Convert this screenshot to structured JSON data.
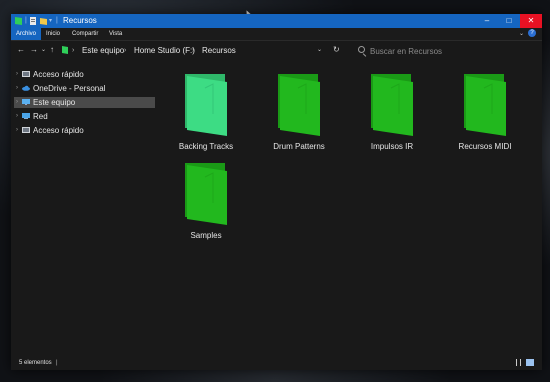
{
  "window": {
    "title": "Recursos",
    "min": "–",
    "max": "□",
    "close": "✕"
  },
  "ribbon": {
    "tabs": [
      "Archivo",
      "Inicio",
      "Compartir",
      "Vista"
    ],
    "help": "?",
    "expand": "⌄"
  },
  "nav": {
    "back": "←",
    "forward": "→",
    "recent": "⌄",
    "up": "↑",
    "breadcrumbs": [
      "Este equipo",
      "Home Studio (F:)",
      "Recursos"
    ],
    "dropdown": "⌄",
    "refresh": "↻",
    "search_placeholder": "Buscar en Recursos"
  },
  "sidebar": {
    "items": [
      {
        "label": "Acceso rápido",
        "icon": "quick-access-icon"
      },
      {
        "label": "OneDrive - Personal",
        "icon": "onedrive-cloud-icon"
      },
      {
        "label": "Este equipo",
        "icon": "this-pc-icon",
        "selected": true
      },
      {
        "label": "Red",
        "icon": "network-icon"
      },
      {
        "label": "Acceso rápido",
        "icon": "quick-access-icon"
      }
    ]
  },
  "folders": [
    {
      "name": "Backing Tracks",
      "color": "#3ddc84"
    },
    {
      "name": "Drum Patterns",
      "color": "#22b81e"
    },
    {
      "name": "Impulsos IR",
      "color": "#22b81e"
    },
    {
      "name": "Recursos MIDI",
      "color": "#22b81e"
    },
    {
      "name": "Samples",
      "color": "#22b81e"
    }
  ],
  "status": {
    "count": "5 elementos",
    "sep": "|"
  },
  "colors": {
    "accent": "#1565c0",
    "folder_green": "#22b81e",
    "folder_mint": "#3ddc84",
    "close_red": "#e81123"
  }
}
